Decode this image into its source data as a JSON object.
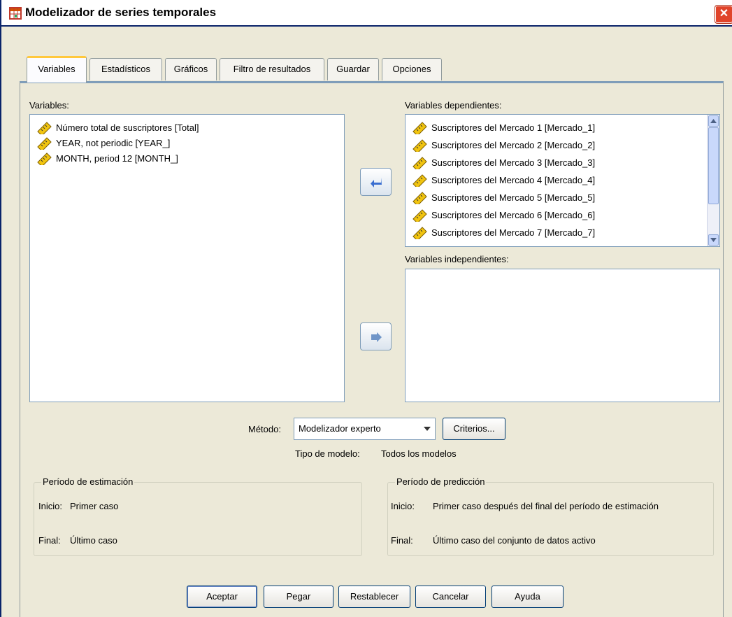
{
  "window": {
    "title": "Modelizador de series temporales",
    "close_glyph": "✕"
  },
  "tabs": [
    {
      "label": "Variables",
      "active": true
    },
    {
      "label": "Estadísticos"
    },
    {
      "label": "Gráficos"
    },
    {
      "label": "Filtro de resultados"
    },
    {
      "label": "Guardar"
    },
    {
      "label": "Opciones"
    }
  ],
  "variables_panel": {
    "label": "Variables:",
    "items": [
      "Número total de suscriptores [Total]",
      "YEAR, not periodic [YEAR_]",
      "MONTH, period 12 [MONTH_]"
    ]
  },
  "dependent_panel": {
    "label": "Variables dependientes:",
    "items": [
      "Suscriptores del Mercado 1 [Mercado_1]",
      "Suscriptores del Mercado 2 [Mercado_2]",
      "Suscriptores del Mercado 3 [Mercado_3]",
      "Suscriptores del Mercado 4 [Mercado_4]",
      "Suscriptores del Mercado 5 [Mercado_5]",
      "Suscriptores del Mercado 6 [Mercado_6]",
      "Suscriptores del Mercado 7 [Mercado_7]"
    ]
  },
  "independent_panel": {
    "label": "Variables independientes:",
    "items": []
  },
  "method": {
    "label": "Método:",
    "value": "Modelizador experto",
    "criteria_button": "Criterios...",
    "model_type_label": "Tipo de modelo:",
    "model_type_value": "Todos los modelos"
  },
  "estimation_period": {
    "title": "Período de estimación",
    "start_label": "Inicio:",
    "start_value": "Primer caso",
    "end_label": "Final:",
    "end_value": "Último caso"
  },
  "prediction_period": {
    "title": "Período de predicción",
    "start_label": "Inicio:",
    "start_value": "Primer caso después del final del período de estimación",
    "end_label": "Final:",
    "end_value": "Último caso del conjunto de datos activo"
  },
  "buttons": {
    "ok": "Aceptar",
    "paste": "Pegar",
    "reset": "Restablecer",
    "cancel": "Cancelar",
    "help": "Ayuda"
  },
  "icons": {
    "variable_icon": "ruler-scale-icon",
    "arrow_left": "arrow-left-icon",
    "arrow_right": "arrow-right-icon"
  },
  "colors": {
    "dialog_bg": "#ece9d8",
    "active_tab_accent": "#ffc83c",
    "button_arrow": "#3a6ed0"
  }
}
